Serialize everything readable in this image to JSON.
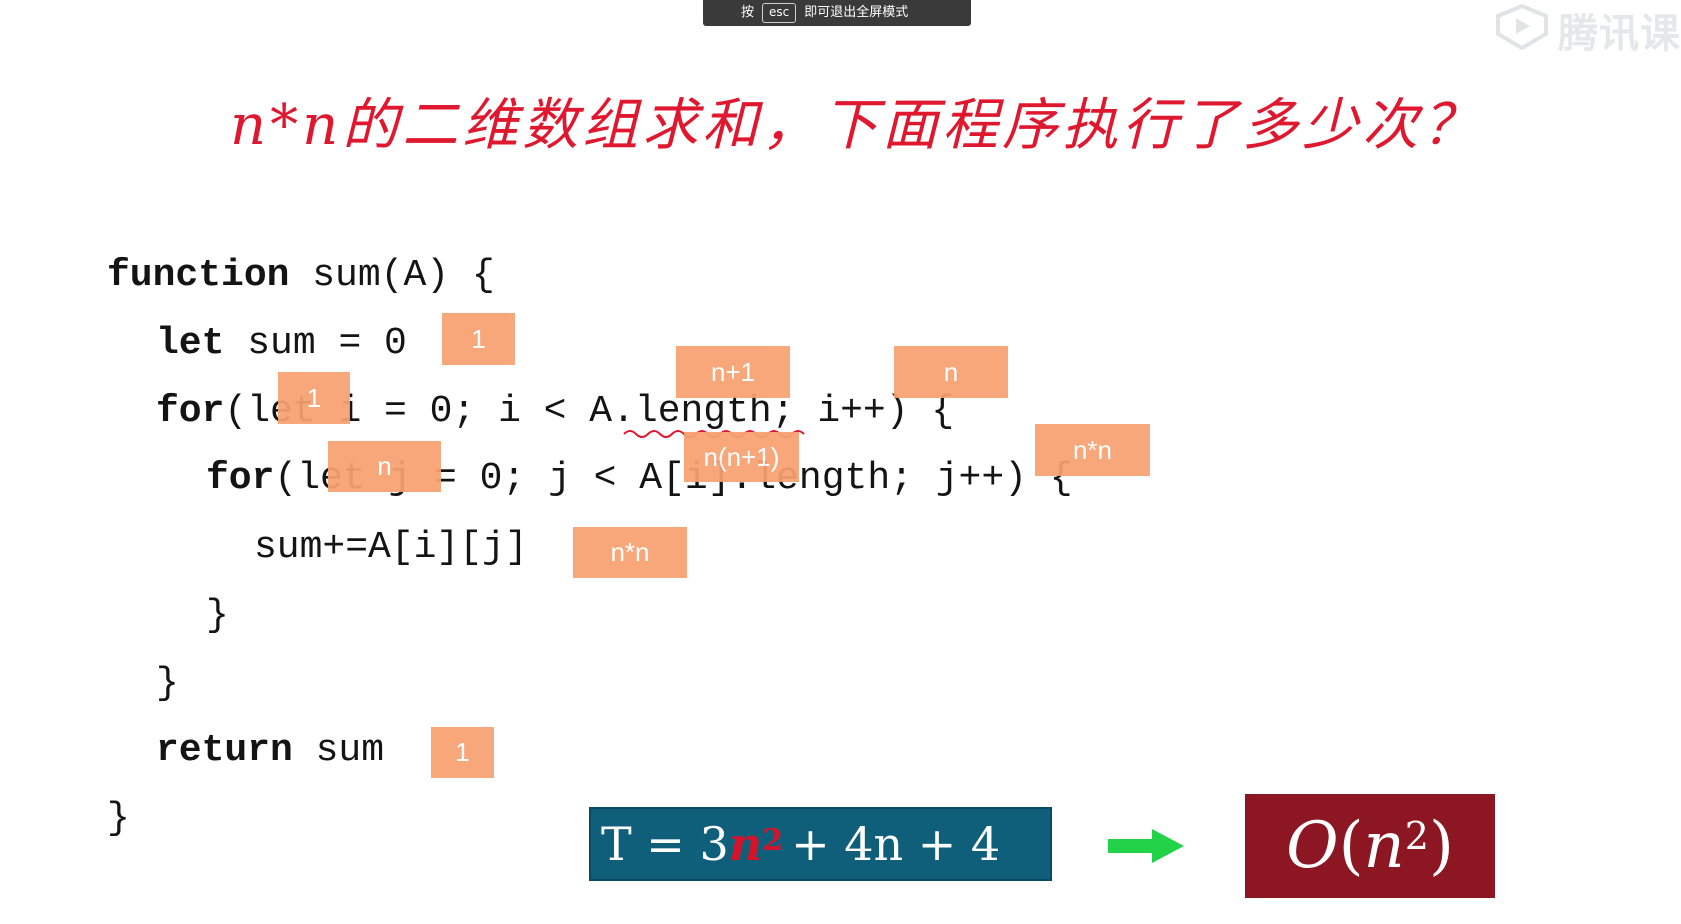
{
  "overlay": {
    "esc_hint_prefix": "按",
    "esc_key": "esc",
    "esc_hint_suffix": "即可退出全屏模式"
  },
  "watermark": {
    "text": "腾讯课"
  },
  "slide": {
    "heading": "n*n的二维数组求和，下面程序执行了多少次？",
    "code": {
      "l1_kw": "function",
      "l1_rest": " sum(A) {",
      "l2_kw": "let",
      "l2_rest": " sum = 0",
      "l3_kw": "for",
      "l3_rest": "(let i = 0; i < A.length; i++) {",
      "l4_kw": "for",
      "l4_rest": "(let j = 0; j < A[i].length; j++) {",
      "l5": "sum+=A[i][j]",
      "l6": "}",
      "l7": "}",
      "l8_kw": "return",
      "l8_rest": " sum",
      "l9": "}"
    },
    "annotations": {
      "a_sum": "1",
      "a_let_i": "1",
      "a_length": "n+1",
      "a_iinc": "n",
      "a_let_j": "n",
      "a_inner_len": "n(n+1)",
      "a_jinc": "n*n",
      "a_body": "n*n",
      "a_return": "1"
    },
    "formula": {
      "lhs": "T = 3",
      "n": "n",
      "sup": "2",
      "rest": "+ 4n + 4"
    },
    "big_o": {
      "o": "O",
      "open": "(",
      "n": "n",
      "sup": "2",
      "close": ")"
    }
  },
  "colors": {
    "heading": "#e0182f",
    "tag_bg": "#f8a170",
    "formula_bg": "#0f5e7a",
    "bigo_bg": "#8c1621",
    "arrow": "#22d34a"
  }
}
